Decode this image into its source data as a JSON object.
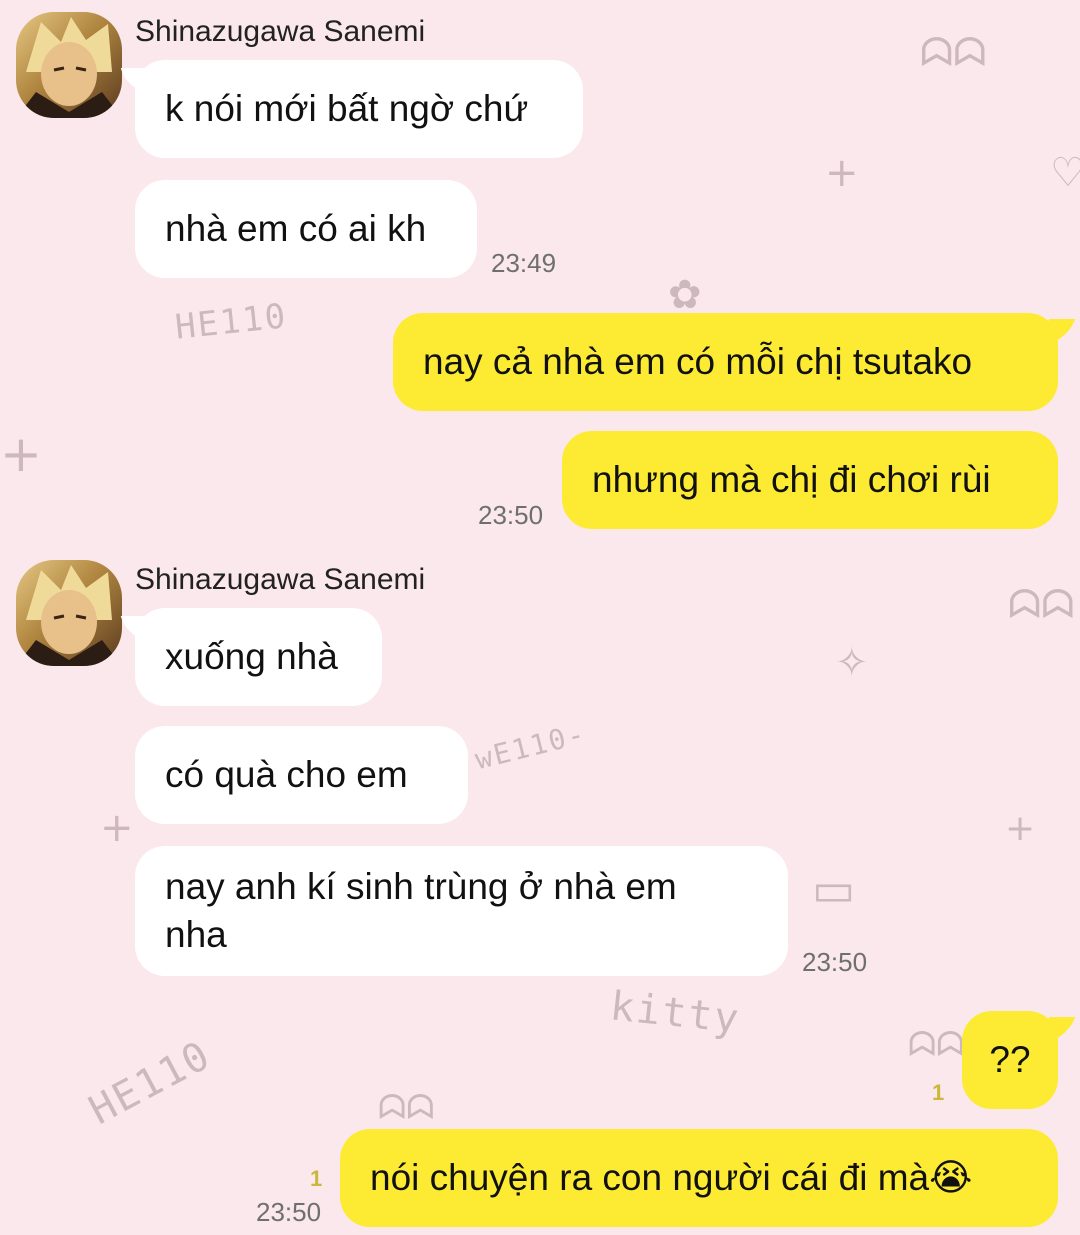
{
  "background": {
    "color": "#fae8ec",
    "doodle_color": "#cdb9bd"
  },
  "colors": {
    "incoming_bubble": "#ffffff",
    "outgoing_bubble": "#fdeb33",
    "unread": "#c9b83a",
    "timestamp": "#6f6f6f"
  },
  "groups": [
    {
      "sender": "Shinazugawa Sanemi",
      "messages": [
        "k nói mới bất ngờ chứ",
        "nhà em có ai kh"
      ],
      "time": "23:49"
    },
    {
      "outgoing": [
        "nay cả nhà em có mỗi chị tsutako",
        "nhưng mà chị đi chơi rùi"
      ],
      "time": "23:50"
    },
    {
      "sender": "Shinazugawa Sanemi",
      "messages": [
        "xuống nhà",
        "có quà cho em",
        "nay anh kí sinh trùng ở nhà em nha"
      ],
      "time": "23:50"
    },
    {
      "outgoing": [
        "??",
        "nói chuyện ra con người cái đi mà😭"
      ],
      "unread": [
        "1",
        "1"
      ],
      "time": "23:50"
    }
  ]
}
